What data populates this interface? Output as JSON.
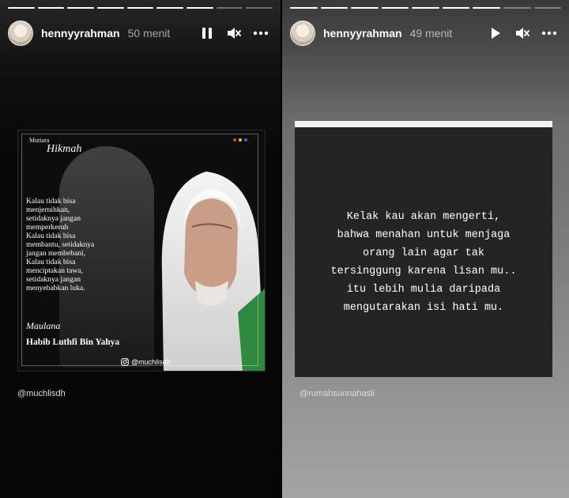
{
  "left_story": {
    "progress": {
      "total": 9,
      "completed": 7
    },
    "username": "hennyyrahman",
    "time": "50 menit",
    "playback_icon": "pause-icon",
    "volume_icon": "mute-icon",
    "more_icon": "more-icon",
    "poster": {
      "header_small": "Mutiara",
      "header_script": "Hikmah",
      "quote_lines": [
        "Kalau tidak bisa",
        "menjernihkan,",
        "setidaknya jangan",
        "memperkeruh",
        "Kalau tidak bisa",
        "membantu, setidaknya",
        "jangan membebani,",
        "Kalau tidak bisa",
        "menciptakan tawa,",
        "setidaknya jangan",
        "menyebabkan luka."
      ],
      "title_script": "Maulana",
      "name": "Habib Luthfi Bin Yahya",
      "handle": "@muchlisdh",
      "accent_colors": [
        "#e03a3a",
        "#f2b824",
        "#2b6fd6"
      ]
    },
    "source_mention": "@muchlisdh"
  },
  "right_story": {
    "progress": {
      "total": 9,
      "completed": 7
    },
    "username": "hennyyrahman",
    "time": "49 menit",
    "playback_icon": "play-icon",
    "volume_icon": "mute-icon",
    "more_icon": "more-icon",
    "quote_lines": [
      "Kelak kau akan mengerti,",
      "bahwa menahan untuk menjaga",
      "orang lain agar tak",
      "tersinggung karena lisan mu..",
      "itu lebih mulia daripada",
      "mengutarakan isi hati mu."
    ],
    "source_mention": "@rumahsunnahasli"
  }
}
